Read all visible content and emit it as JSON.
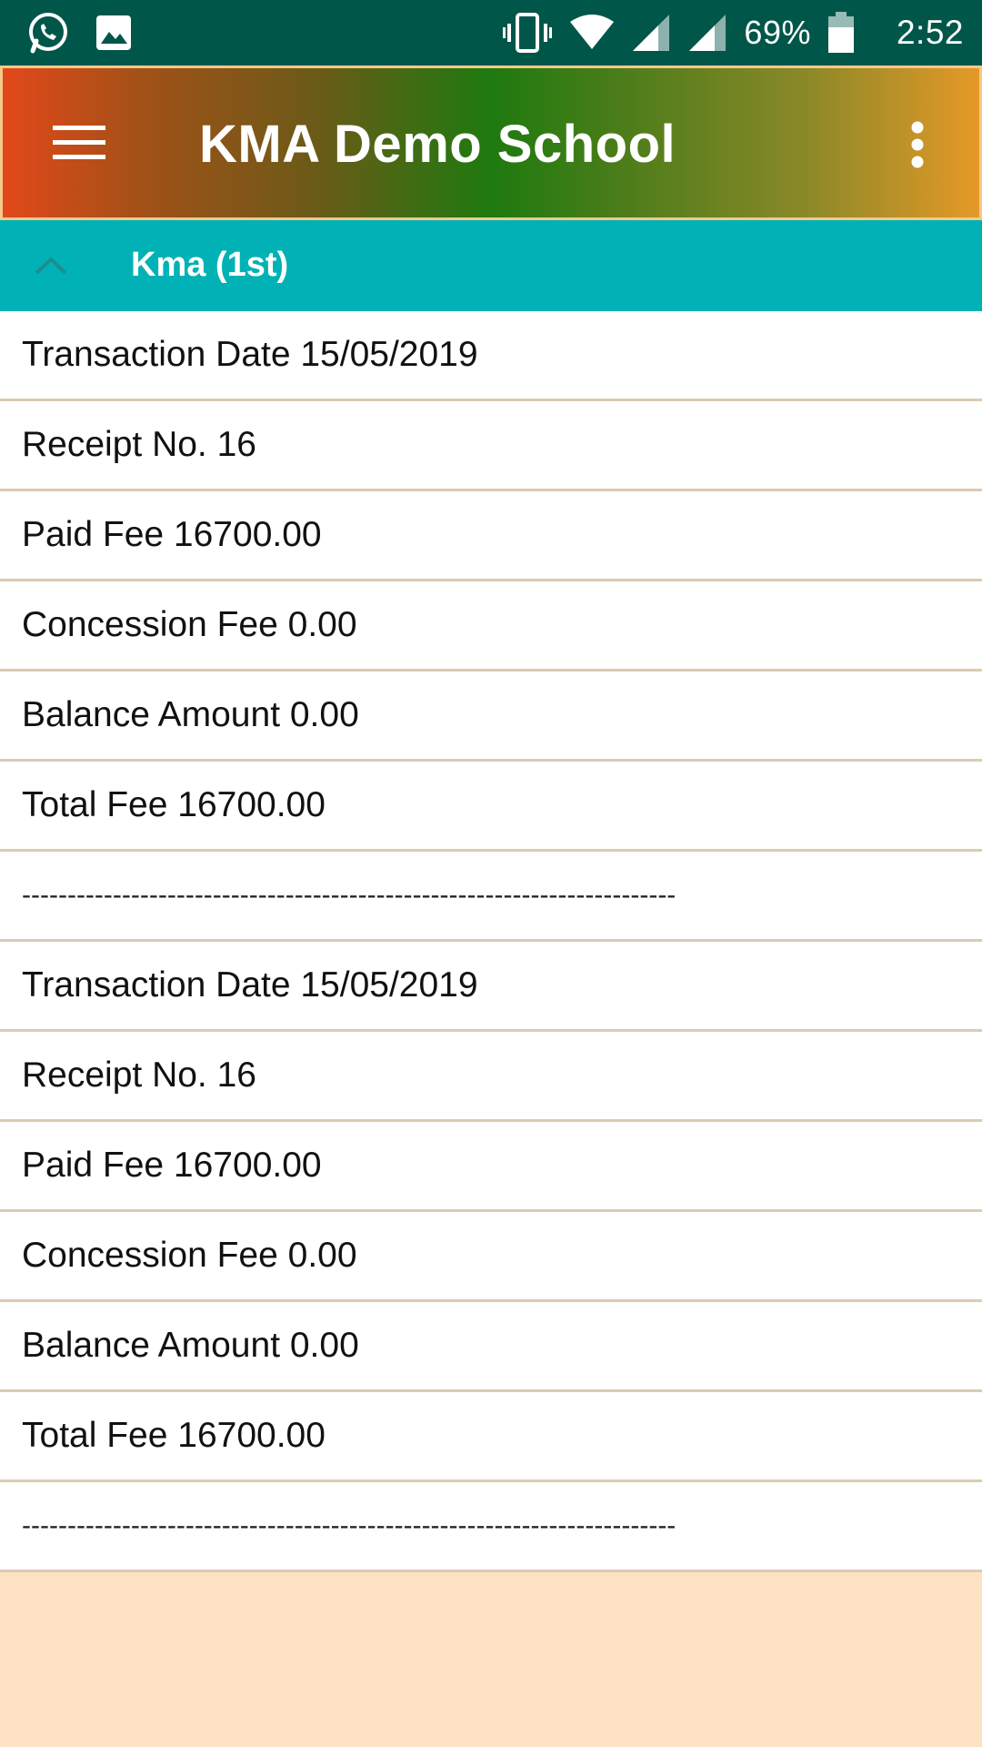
{
  "status_bar": {
    "battery": "69%",
    "time": "2:52",
    "icons": [
      "whatsapp-icon",
      "image-icon",
      "vibrate-icon",
      "wifi-icon",
      "signal-icon",
      "signal-icon",
      "battery-icon"
    ]
  },
  "toolbar": {
    "title": "KMA Demo School",
    "menu_icon": "hamburger-menu-icon",
    "overflow_icon": "more-vert-icon"
  },
  "group": {
    "title": "Kma (1st)",
    "icon": "chevron-up-icon"
  },
  "rows": [
    "Transaction Date 15/05/2019",
    "Receipt No. 16",
    "Paid Fee 16700.00",
    "Concession Fee 0.00",
    "Balance Amount 0.00",
    "Total Fee 16700.00",
    "------------------------------------------------------------------------",
    "Transaction Date 15/05/2019",
    "Receipt No. 16",
    "Paid Fee 16700.00",
    "Concession Fee 0.00",
    "Balance Amount 0.00",
    "Total Fee 16700.00",
    "------------------------------------------------------------------------"
  ],
  "colors": {
    "status_bar": "#01564a",
    "group_header": "#00b2b5",
    "divider": "#dccab3",
    "page_background": "#fde3c3"
  }
}
